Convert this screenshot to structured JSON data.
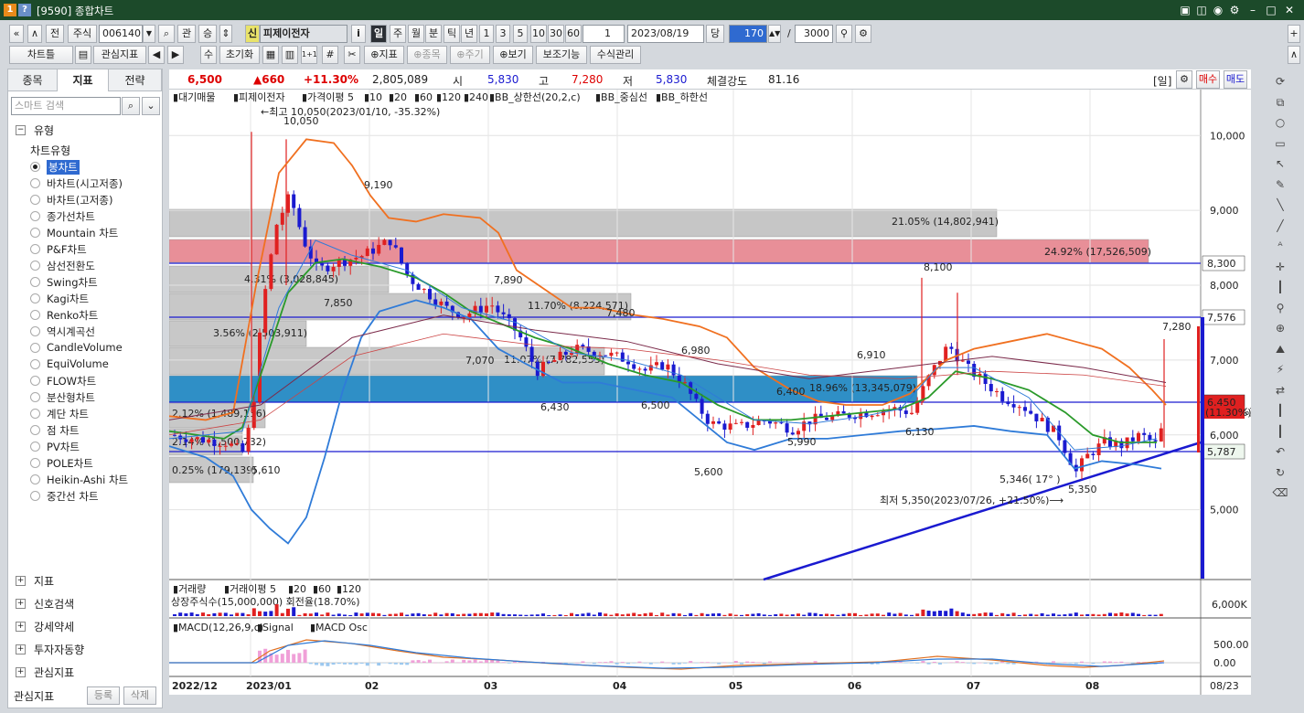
{
  "window": {
    "title": "[9590] 종합차트",
    "icon_label": "1 ?"
  },
  "toolbar1": {
    "prev": "«",
    "up": "∧",
    "front": "전",
    "market": "주식",
    "code": "006140",
    "code_drop": "▼",
    "search": "⌕",
    "rel": "관",
    "updown": "승",
    "updown2": "⇕",
    "sin": "신",
    "stock_name": "피제이전자",
    "info": "i",
    "periods": [
      "일",
      "주",
      "월",
      "분",
      "틱",
      "년"
    ],
    "minutes": [
      "1",
      "3",
      "5",
      "10",
      "30",
      "60"
    ],
    "count": "1",
    "date": "2023/08/19",
    "price_label": "당",
    "zoom": "170",
    "slash": "/",
    "total": "3000"
  },
  "toolbar2": {
    "chart_table": "차트틀",
    "interest": "관심지표",
    "num": "수",
    "reset": "초기화",
    "indicator": "지표",
    "item": "종목",
    "cycle": "주기",
    "view": "보기",
    "aux": "보조기능",
    "formula": "수식관리"
  },
  "left_panel": {
    "tabs": [
      "종목",
      "지표",
      "전략"
    ],
    "search_placeholder": "스마트 검색",
    "section_type": "유형",
    "chart_types_title": "차트유형",
    "chart_types": [
      "봉차트",
      "바차트(시고저종)",
      "바차트(고저종)",
      "종가선차트",
      "Mountain 차트",
      "P&F차트",
      "삼선전환도",
      "Swing차트",
      "Kagi차트",
      "Renko차트",
      "역시계곡선",
      "CandleVolume",
      "EquiVolume",
      "FLOW차트",
      "분산형차트",
      "계단 차트",
      "점 차트",
      "PV차트",
      "POLE차트",
      "Heikin-Ashi 차트",
      "중간선 차트"
    ],
    "selected": "봉차트",
    "groups": [
      "지표",
      "신호검색",
      "강세약세",
      "투자자동향",
      "관심지표"
    ],
    "footer_label": "관심지표",
    "footer_register": "등록",
    "footer_delete": "삭제"
  },
  "quote": {
    "price": "6,500",
    "change": "▲660",
    "rate": "+11.30%",
    "volume": "2,805,089",
    "open_label": "시",
    "open": "5,830",
    "high_label": "고",
    "high": "7,280",
    "low_label": "저",
    "low": "5,830",
    "strength_label": "체결강도",
    "strength": "81.16",
    "period_label": "[일]",
    "buy": "매수",
    "sell": "매도"
  },
  "legend": {
    "items": [
      "대기매물",
      "피제이전자",
      "가격이평 5",
      "10",
      "20",
      "60",
      "120",
      "240",
      "BB_상한선(20,2,c)",
      "BB_중심선",
      "BB_하한선"
    ]
  },
  "annotations": {
    "max": "←최고 10,050(2023/01/10, -35.32%)",
    "min": "최저 5,350(2023/07/26, +21.50%)⟶",
    "peak": "10,050",
    "p1": "9,190",
    "p2": "7,890",
    "p3": "7,480",
    "p4": "6,980",
    "p5": "6,910",
    "p6": "8,100",
    "p7": "7,280",
    "t1": "7,850",
    "t2": "7,070",
    "t3": "6,430",
    "t4": "6,500",
    "t5": "5,600",
    "t6": "6,400",
    "t7": "5,990",
    "t8": "6,130",
    "t9": "5,350",
    "t10": "5,346( 17° )",
    "t11": "5,610"
  },
  "supply_boxes": [
    "21.05% (14,802,941)",
    "24.92% (17,526,509)",
    "4.31% (3,028,845)",
    "11.70% (8,224,571)",
    "3.56% (2,503,911)",
    "11.07% (7,782,555)",
    "18.96% (13,345,079)",
    "2.12% (1,489,136)",
    "2.14% (1,500,732)",
    "0.25% (179,139)"
  ],
  "price_axis": {
    "labels": [
      "10,000",
      "9,000",
      "8,000",
      "7,000",
      "6,000",
      "5,000"
    ],
    "mark1": "8,300",
    "mark2": "7,576",
    "mark3": "6,450",
    "mark3b": "(11.30%)",
    "mark4": "5,787"
  },
  "volume_pane": {
    "legend": [
      "거래량",
      "거래이평 5",
      "20",
      "60",
      "120"
    ],
    "info": "상장주식수(15,000,000) 회전율(18.70%)",
    "axis": "6,000K"
  },
  "macd_pane": {
    "legend": [
      "MACD(12,26,9,c)",
      "Signal",
      "MACD Osc"
    ],
    "axis": [
      "500.00",
      "0.00"
    ]
  },
  "date_axis": {
    "labels": [
      "2022/12",
      "2023/01",
      "02",
      "03",
      "04",
      "05",
      "06",
      "07",
      "08"
    ],
    "last": "08/23"
  },
  "colors": {
    "up": "#e02020",
    "down": "#1a1ad0",
    "ma5": "#2a9a2a",
    "ma10": "#2f7bd8",
    "ma20": "#2a9a2a",
    "bb_upper": "#f07020",
    "bb_lower": "#2f7bd8",
    "box_gray": "#c8c8c8",
    "box_red": "#e8909a",
    "box_blue": "#2f8fc6"
  }
}
